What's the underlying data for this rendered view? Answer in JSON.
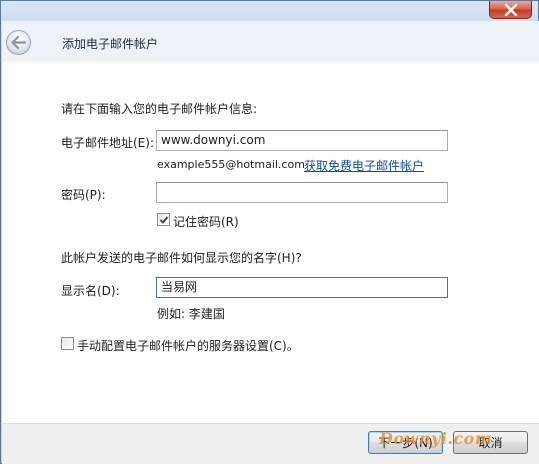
{
  "window": {
    "title": "添加电子邮件帐户"
  },
  "form": {
    "intro": "请在下面输入您的电子邮件帐户信息:",
    "email": {
      "label": "电子邮件地址(E):",
      "value": "www.downyi.com",
      "example": "example555@hotmail.com",
      "link_text": "获取免费电子邮件帐户"
    },
    "password": {
      "label": "密码(P):",
      "value": ""
    },
    "remember_password": {
      "label": "记住密码(R)",
      "checked": true
    },
    "display_section": {
      "question": "此帐户发送的电子邮件如何显示您的名字(H)?"
    },
    "display_name": {
      "label": "显示名(D):",
      "value": "当易网",
      "example": "例如: 李建国"
    },
    "manual_config": {
      "label": "手动配置电子邮件帐户的服务器设置(C)。",
      "checked": false
    }
  },
  "footer": {
    "next_label": "下一步(N)",
    "cancel_label": "取消",
    "watermark": "Downyi.com"
  }
}
